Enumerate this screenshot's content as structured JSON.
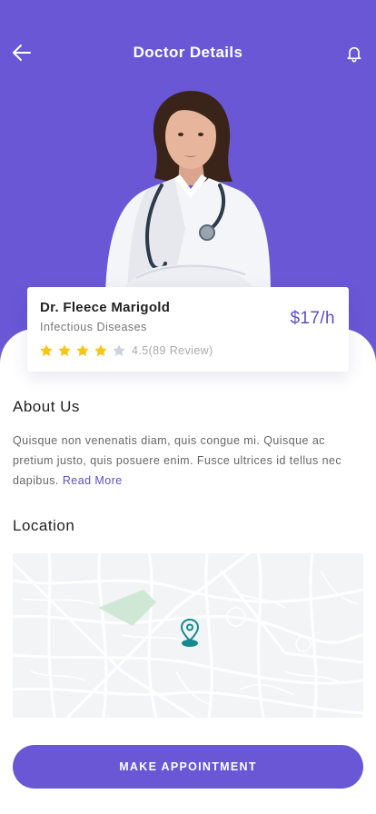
{
  "header": {
    "title": "Doctor Details",
    "back_icon": "arrow-left-icon",
    "bell_icon": "bell-icon"
  },
  "doctor": {
    "name": "Dr. Fleece Marigold",
    "specialty": "Infectious Diseases",
    "price": "$17/h",
    "rating": 4,
    "rating_max": 5,
    "rating_text": "4.5(89 Review)"
  },
  "about": {
    "heading": "About Us",
    "body": "Quisque non venenatis diam, quis congue mi. Quisque ac pretium justo, quis posuere enim. Fusce ultrices id tellus nec dapibus.",
    "read_more": "Read More"
  },
  "location": {
    "heading": "Location",
    "marker_icon": "map-pin-icon"
  },
  "cta": {
    "label": "MAKE APPOINTMENT"
  },
  "colors": {
    "primary": "#6a57d6",
    "accent_text": "#5d4ec4",
    "star_filled": "#f5c518",
    "star_empty": "#d0d3da",
    "map_pin": "#138a8f"
  }
}
